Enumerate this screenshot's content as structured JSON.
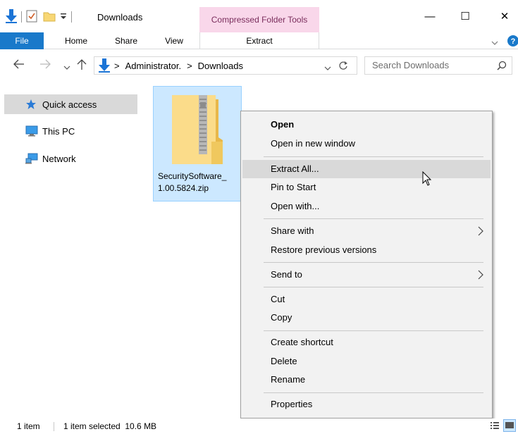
{
  "window": {
    "title": "Downloads",
    "context_tab_group": "Compressed Folder Tools",
    "minimize": "—",
    "maximize": "☐",
    "close": "✕"
  },
  "ribbon": {
    "tabs": [
      "File",
      "Home",
      "Share",
      "View"
    ],
    "extract_tab": "Extract"
  },
  "address": {
    "path": [
      "Administrator.",
      "Downloads"
    ],
    "separator": ">",
    "search_placeholder": "Search Downloads"
  },
  "sidebar": {
    "items": [
      {
        "label": "Quick access",
        "icon": "star-icon",
        "selected": true
      },
      {
        "label": "This PC",
        "icon": "computer-icon",
        "selected": false
      },
      {
        "label": "Network",
        "icon": "network-icon",
        "selected": false
      }
    ]
  },
  "file": {
    "name_line1": "SecuritySoftware_",
    "name_line2": "1.00.5824.zip",
    "icon": "zip-folder-icon"
  },
  "context_menu": {
    "items": [
      {
        "label": "Open"
      },
      {
        "label": "Open in new window"
      },
      {
        "label": "Extract All..."
      },
      {
        "label": "Pin to Start"
      },
      {
        "label": "Open with..."
      },
      {
        "label": "Share with"
      },
      {
        "label": "Restore previous versions"
      },
      {
        "label": "Send to"
      },
      {
        "label": "Cut"
      },
      {
        "label": "Copy"
      },
      {
        "label": "Create shortcut"
      },
      {
        "label": "Delete"
      },
      {
        "label": "Rename"
      },
      {
        "label": "Properties"
      }
    ]
  },
  "status": {
    "item_count": "1 item",
    "selection": "1 item selected  10.6 MB"
  },
  "colors": {
    "file_tab": "#1979ca",
    "context_tab": "#f9d7ea",
    "selection": "#cce8ff",
    "download_arrow": "#1b74d6",
    "folder": "#f8d775"
  }
}
